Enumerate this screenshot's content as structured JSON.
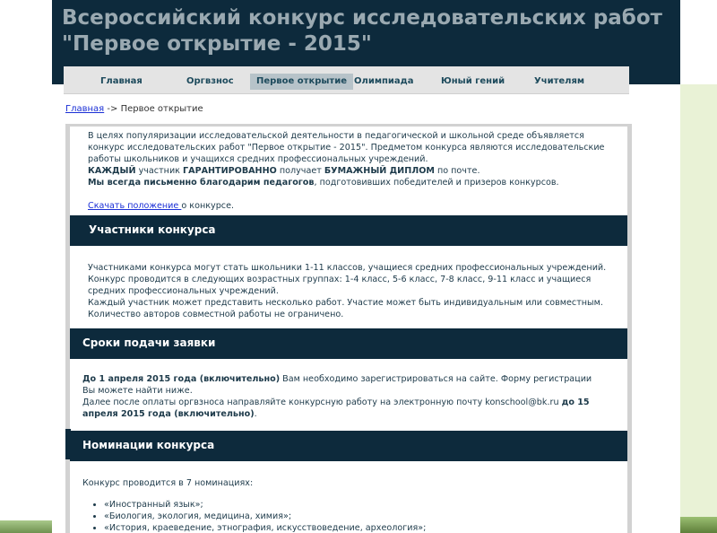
{
  "header": {
    "title": "Всероссийский конкурс исследовательских работ \"Первое открытие - 2015\""
  },
  "nav": {
    "items": [
      {
        "label": "Главная",
        "active": false
      },
      {
        "label": "Оргвзнос",
        "active": false
      },
      {
        "label": "Первое открытие",
        "active": true
      },
      {
        "label": "Олимпиада",
        "active": false
      },
      {
        "label": "Юный гений",
        "active": false
      },
      {
        "label": "Учителям",
        "active": false
      }
    ]
  },
  "breadcrumb": {
    "home": "Главная",
    "separator": " -> ",
    "current": "Первое открытие"
  },
  "intro": {
    "p1": "В целях популяризации исследовательской деятельности в педагогической и школьной среде объявляется конкурс исследовательских работ \"Первое открытие - 2015\". Предметом конкурса являются исследовательские работы школьников и учащихся средних профессиональных учреждений.",
    "p2_b1": "КАЖДЫЙ",
    "p2_t1": " участник ",
    "p2_b2": "ГАРАНТИРОВАННО",
    "p2_t2": " получает ",
    "p2_b3": "БУМАЖНЫЙ ДИПЛОМ",
    "p2_t3": " по почте.",
    "p3_b": "Мы всегда письменно благодарим педагогов",
    "p3_t": ", подготовивших победителей и призеров конкурсов.",
    "download_link": "Скачать положение ",
    "download_rest": "о конкурсе."
  },
  "participants": {
    "heading": "Участники конкурса",
    "p1": "Участниками конкурса могут стать школьники 1-11 классов, учащиеся средних профессиональных учреждений.",
    "p2": "Конкурс проводится в следующих возрастных группах: 1-4 класс, 5-6 класс, 7-8 класс, 9-11 класс и учащиеся средних профессиональных учреждений.",
    "p3": "Каждый участник может представить несколько работ. Участие может быть индивидуальным или совместным. Количество авторов совместной работы не ограничено."
  },
  "deadlines": {
    "heading": "Сроки подачи заявки",
    "p1_b": "До 1 апреля 2015 года (включительно)",
    "p1_t": " Вам необходимо зарегистрироваться на сайте. Форму регистрации Вы можете найти ниже.",
    "p2_t": "Далее после оплаты оргвзноса направляйте  конкурсную работу на электронную почту konschool@bk.ru ",
    "p2_b": "до 15 апреля 2015 года (включительно)",
    "p2_end": "."
  },
  "nominations": {
    "heading": "Номинации конкурса",
    "intro": "Конкурс проводится в 7 номинациях:",
    "items": [
      "«Иностранный язык»;",
      "«Биология, экология, медицина, химия»;",
      "«История, краеведение, этнография, искусствоведение, археология»;"
    ]
  },
  "colors": {
    "header_bg": "#0d2a3c",
    "nav_bg": "#e4e4e4",
    "nav_active_bg": "#b7c3c9",
    "link": "#1a2fd6",
    "text": "#1d3a4a"
  }
}
